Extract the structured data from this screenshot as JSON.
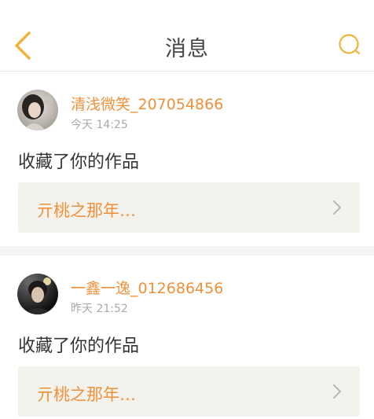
{
  "header": {
    "title": "消息",
    "back_icon": "chevron-left-icon",
    "search_icon": "search-icon",
    "accent_color": "#f0b43c"
  },
  "messages": [
    {
      "username": "清浅微笑_207054866",
      "time": "今天 14:25",
      "action": "收藏了你的作品",
      "work_title": "亓桃之那年…"
    },
    {
      "username": "一鑫一逸_012686456",
      "time": "昨天 21:52",
      "action": "收藏了你的作品",
      "work_title": "亓桃之那年…"
    }
  ],
  "colors": {
    "username": "#f0903a",
    "work_title": "#f0903a",
    "link_background": "#f3f2ec"
  }
}
